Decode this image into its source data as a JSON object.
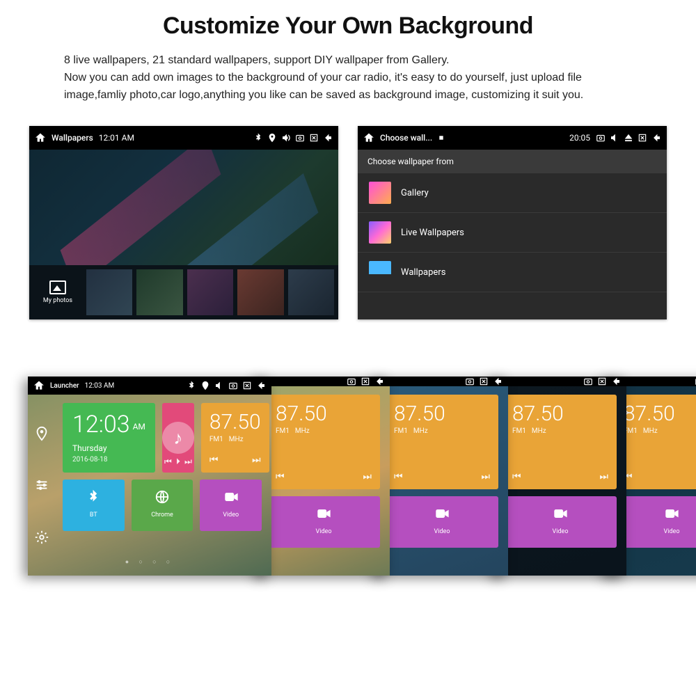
{
  "headline": "Customize Your Own Background",
  "copy_line1": "8 live wallpapers, 21 standard wallpapers, support DIY wallpaper from Gallery.",
  "copy_line2": "Now you can add own images to the background of your car radio, it's easy to do yourself, just upload file image,famliy photo,car logo,anything you like can be saved as background image, customizing it suit you.",
  "left_screen": {
    "title": "Wallpapers",
    "time": "12:01 AM",
    "my_photos": "My photos"
  },
  "right_screen": {
    "title": "Choose wall...",
    "time": "20:05",
    "header": "Choose wallpaper from",
    "items": {
      "gallery": "Gallery",
      "live": "Live Wallpapers",
      "wallpapers": "Wallpapers"
    }
  },
  "launcher": {
    "title": "Launcher",
    "time": "12:03 AM",
    "clock": {
      "time": "12:03",
      "ampm": "AM",
      "day": "Thursday",
      "date": "2016-08-18"
    },
    "radio": {
      "freq": "87.50",
      "band": "FM1",
      "unit": "MHz"
    },
    "bt": "BT",
    "chrome": "Chrome",
    "video": "Video"
  }
}
